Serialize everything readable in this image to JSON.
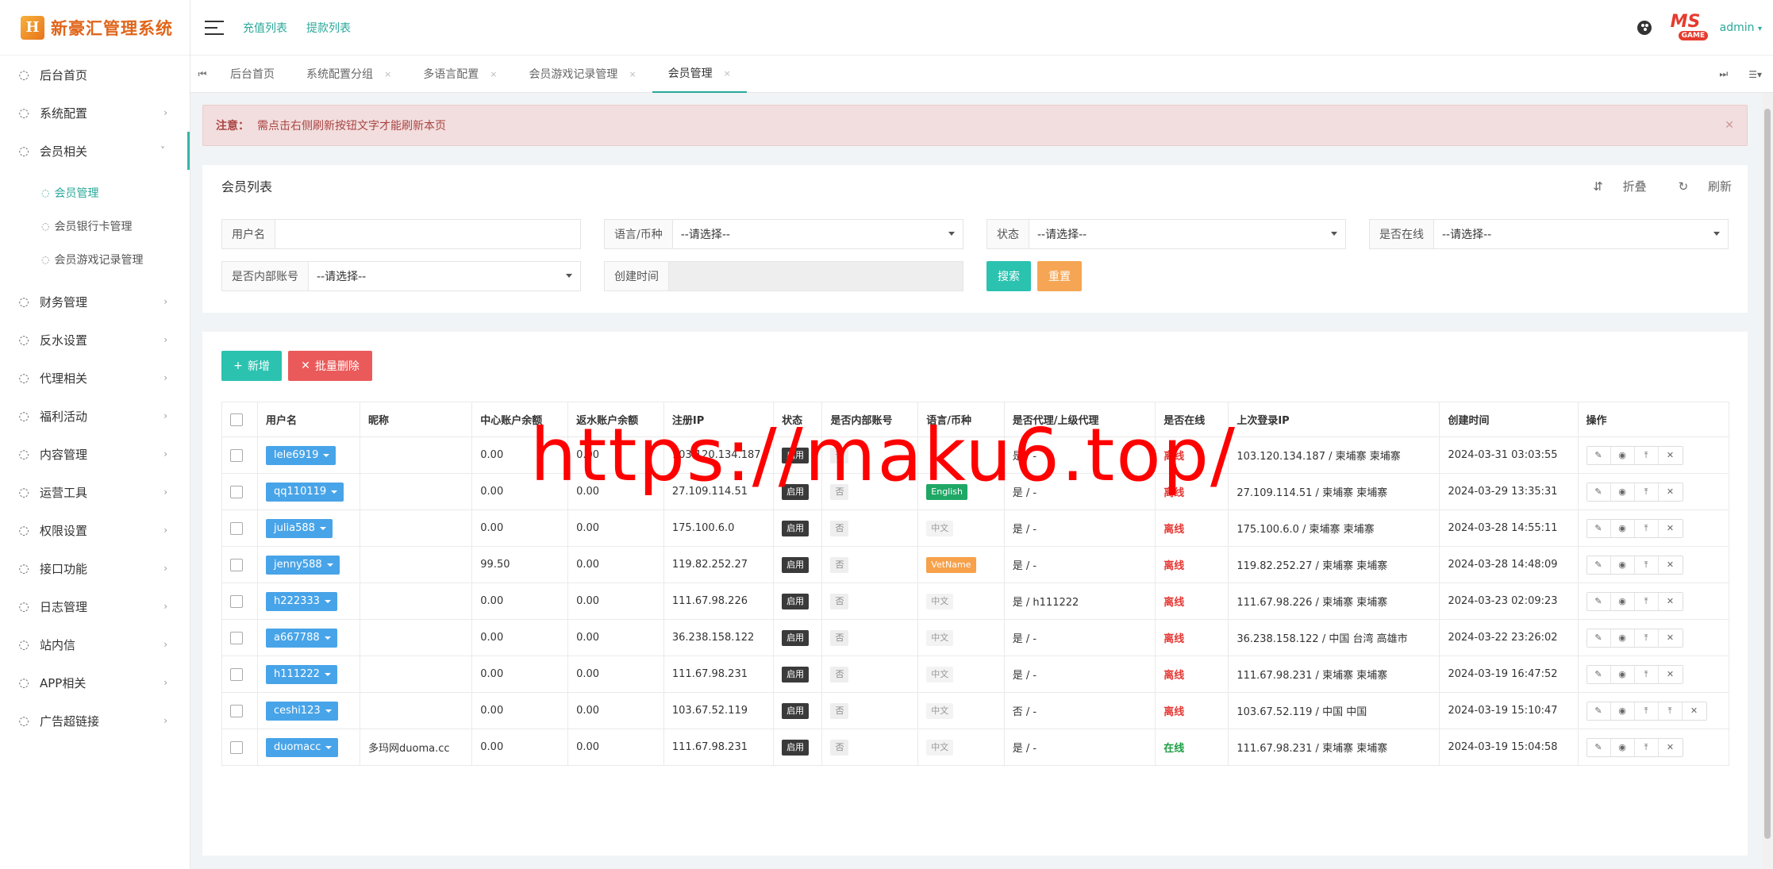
{
  "app": {
    "logo_mark": "H",
    "logo_text": "新豪汇管理系统"
  },
  "sidebar": {
    "items": [
      {
        "label": "后台首页",
        "has_arrow": false
      },
      {
        "label": "系统配置",
        "has_arrow": true
      },
      {
        "label": "会员相关",
        "has_arrow": true,
        "open": true
      },
      {
        "label": "财务管理",
        "has_arrow": true
      },
      {
        "label": "反水设置",
        "has_arrow": true
      },
      {
        "label": "代理相关",
        "has_arrow": true
      },
      {
        "label": "福利活动",
        "has_arrow": true
      },
      {
        "label": "内容管理",
        "has_arrow": true
      },
      {
        "label": "运营工具",
        "has_arrow": true
      },
      {
        "label": "权限设置",
        "has_arrow": true
      },
      {
        "label": "接口功能",
        "has_arrow": true
      },
      {
        "label": "日志管理",
        "has_arrow": true
      },
      {
        "label": "站内信",
        "has_arrow": true
      },
      {
        "label": "APP相关",
        "has_arrow": true
      },
      {
        "label": "广告超链接",
        "has_arrow": true
      }
    ],
    "submenu": [
      {
        "label": "会员管理",
        "active": true
      },
      {
        "label": "会员银行卡管理",
        "active": false
      },
      {
        "label": "会员游戏记录管理",
        "active": false
      }
    ]
  },
  "header": {
    "links": [
      "充值列表",
      "提款列表"
    ],
    "avatar_text": "MS",
    "avatar_sub": "GAME",
    "admin": "admin"
  },
  "tabs": [
    {
      "label": "后台首页",
      "closable": false,
      "active": false
    },
    {
      "label": "系统配置分组",
      "closable": true,
      "active": false
    },
    {
      "label": "多语言配置",
      "closable": true,
      "active": false
    },
    {
      "label": "会员游戏记录管理",
      "closable": true,
      "active": false
    },
    {
      "label": "会员管理",
      "closable": true,
      "active": true
    }
  ],
  "notice": {
    "prefix": "注意：",
    "text": "需点击右侧刷新按钮文字才能刷新本页"
  },
  "filter": {
    "title": "会员列表",
    "collapse": "折叠",
    "refresh": "刷新",
    "fields": {
      "username": {
        "label": "用户名",
        "value": ""
      },
      "language": {
        "label": "语言/币种",
        "value": "--请选择--"
      },
      "status": {
        "label": "状态",
        "value": "--请选择--"
      },
      "online": {
        "label": "是否在线",
        "value": "--请选择--"
      },
      "internal": {
        "label": "是否内部账号",
        "value": "--请选择--"
      },
      "created": {
        "label": "创建时间",
        "value": ""
      }
    },
    "search_btn": "搜索",
    "reset_btn": "重置"
  },
  "toolbar": {
    "add": "新增",
    "batch_delete": "批量删除"
  },
  "table": {
    "columns": [
      "",
      "用户名",
      "昵称",
      "中心账户余额",
      "返水账户余额",
      "注册IP",
      "状态",
      "是否内部账号",
      "语言/币种",
      "是否代理/上级代理",
      "是否在线",
      "上次登录IP",
      "创建时间",
      "操作"
    ],
    "rows": [
      {
        "username": "lele6919",
        "nickname": "",
        "balance": "0.00",
        "rebate": "0.00",
        "reg_ip": "103.120.134.187",
        "status": "启用",
        "internal": "否",
        "lang": "",
        "lang_style": "none",
        "agent": "是 / -",
        "online": "离线",
        "last_ip": "103.120.134.187 / 柬埔寨 柬埔寨",
        "created": "2024-03-31 03:03:55",
        "ops": 4
      },
      {
        "username": "qq110119",
        "nickname": "",
        "balance": "0.00",
        "rebate": "0.00",
        "reg_ip": "27.109.114.51",
        "status": "启用",
        "internal": "否",
        "lang": "English",
        "lang_style": "green",
        "agent": "是 / -",
        "online": "离线",
        "last_ip": "27.109.114.51 / 柬埔寨 柬埔寨",
        "created": "2024-03-29 13:35:31",
        "ops": 4
      },
      {
        "username": "julia588",
        "nickname": "",
        "balance": "0.00",
        "rebate": "0.00",
        "reg_ip": "175.100.6.0",
        "status": "启用",
        "internal": "否",
        "lang": "中文",
        "lang_style": "gray",
        "agent": "是 / -",
        "online": "离线",
        "last_ip": "175.100.6.0 / 柬埔寨 柬埔寨",
        "created": "2024-03-28 14:55:11",
        "ops": 4
      },
      {
        "username": "jenny588",
        "nickname": "",
        "balance": "99.50",
        "rebate": "0.00",
        "reg_ip": "119.82.252.27",
        "status": "启用",
        "internal": "否",
        "lang": "VetName",
        "lang_style": "orange",
        "agent": "是 / -",
        "online": "离线",
        "last_ip": "119.82.252.27 / 柬埔寨 柬埔寨",
        "created": "2024-03-28 14:48:09",
        "ops": 4
      },
      {
        "username": "h222333",
        "nickname": "",
        "balance": "0.00",
        "rebate": "0.00",
        "reg_ip": "111.67.98.226",
        "status": "启用",
        "internal": "否",
        "lang": "中文",
        "lang_style": "gray",
        "agent": "是 / h111222",
        "online": "离线",
        "last_ip": "111.67.98.226 / 柬埔寨 柬埔寨",
        "created": "2024-03-23 02:09:23",
        "ops": 4
      },
      {
        "username": "a667788",
        "nickname": "",
        "balance": "0.00",
        "rebate": "0.00",
        "reg_ip": "36.238.158.122",
        "status": "启用",
        "internal": "否",
        "lang": "中文",
        "lang_style": "gray",
        "agent": "是 / -",
        "online": "离线",
        "last_ip": "36.238.158.122 / 中国 台湾 高雄市",
        "created": "2024-03-22 23:26:02",
        "ops": 4
      },
      {
        "username": "h111222",
        "nickname": "",
        "balance": "0.00",
        "rebate": "0.00",
        "reg_ip": "111.67.98.231",
        "status": "启用",
        "internal": "否",
        "lang": "中文",
        "lang_style": "gray",
        "agent": "是 / -",
        "online": "离线",
        "last_ip": "111.67.98.231 / 柬埔寨 柬埔寨",
        "created": "2024-03-19 16:47:52",
        "ops": 4
      },
      {
        "username": "ceshi123",
        "nickname": "",
        "balance": "0.00",
        "rebate": "0.00",
        "reg_ip": "103.67.52.119",
        "status": "启用",
        "internal": "否",
        "lang": "中文",
        "lang_style": "gray",
        "agent": "否 / -",
        "online": "离线",
        "last_ip": "103.67.52.119 / 中国 中国",
        "created": "2024-03-19 15:10:47",
        "ops": 5
      },
      {
        "username": "duomacc",
        "nickname": "多玛网duoma.cc",
        "balance": "0.00",
        "rebate": "0.00",
        "reg_ip": "111.67.98.231",
        "status": "启用",
        "internal": "否",
        "lang": "中文",
        "lang_style": "gray",
        "agent": "是 / -",
        "online": "在线",
        "last_ip": "111.67.98.231 / 柬埔寨 柬埔寨",
        "created": "2024-03-19 15:04:58",
        "ops": 4
      }
    ]
  },
  "watermark": "https://maku6.top/",
  "colors": {
    "accent": "#2aa89a",
    "primary_btn": "#2bc2b0",
    "warning_btn": "#f5a553",
    "danger_btn": "#eb5a5a",
    "user_btn": "#48a4e8",
    "offline": "#e53935",
    "online": "#1e9e44"
  }
}
